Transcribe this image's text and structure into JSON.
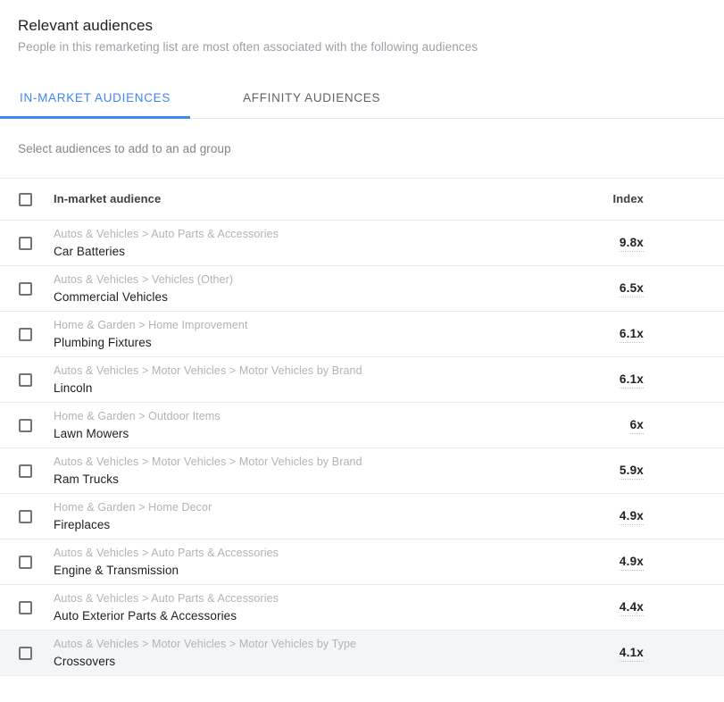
{
  "header": {
    "title": "Relevant audiences",
    "subtitle": "People in this remarketing list are most often associated with the following audiences"
  },
  "tabs": [
    {
      "label": "IN-MARKET AUDIENCES",
      "active": true
    },
    {
      "label": "AFFINITY AUDIENCES",
      "active": false
    }
  ],
  "instruction": "Select audiences to add to an ad group",
  "table": {
    "columns": {
      "audience": "In-market audience",
      "index": "Index"
    },
    "rows": [
      {
        "breadcrumb": "Autos & Vehicles > Auto Parts & Accessories",
        "name": "Car Batteries",
        "index": "9.8x",
        "checked": false,
        "highlight": false
      },
      {
        "breadcrumb": "Autos & Vehicles > Vehicles (Other)",
        "name": "Commercial Vehicles",
        "index": "6.5x",
        "checked": false,
        "highlight": false
      },
      {
        "breadcrumb": "Home & Garden > Home Improvement",
        "name": "Plumbing Fixtures",
        "index": "6.1x",
        "checked": false,
        "highlight": false
      },
      {
        "breadcrumb": "Autos & Vehicles > Motor Vehicles > Motor Vehicles by Brand",
        "name": "Lincoln",
        "index": "6.1x",
        "checked": false,
        "highlight": false
      },
      {
        "breadcrumb": "Home & Garden > Outdoor Items",
        "name": "Lawn Mowers",
        "index": "6x",
        "checked": false,
        "highlight": false
      },
      {
        "breadcrumb": "Autos & Vehicles > Motor Vehicles > Motor Vehicles by Brand",
        "name": "Ram Trucks",
        "index": "5.9x",
        "checked": false,
        "highlight": false
      },
      {
        "breadcrumb": "Home & Garden > Home Decor",
        "name": "Fireplaces",
        "index": "4.9x",
        "checked": false,
        "highlight": false
      },
      {
        "breadcrumb": "Autos & Vehicles > Auto Parts & Accessories",
        "name": "Engine & Transmission",
        "index": "4.9x",
        "checked": false,
        "highlight": false
      },
      {
        "breadcrumb": "Autos & Vehicles > Auto Parts & Accessories",
        "name": "Auto Exterior Parts & Accessories",
        "index": "4.4x",
        "checked": false,
        "highlight": false
      },
      {
        "breadcrumb": "Autos & Vehicles > Motor Vehicles > Motor Vehicles by Type",
        "name": "Crossovers",
        "index": "4.1x",
        "checked": false,
        "highlight": true
      }
    ]
  },
  "colors": {
    "accent": "#4285f4",
    "text_primary": "#202124",
    "text_secondary": "#80868b",
    "breadcrumb": "#b0b3b8",
    "row_highlight": "#f4f5f6",
    "divider": "#e8eaed"
  }
}
